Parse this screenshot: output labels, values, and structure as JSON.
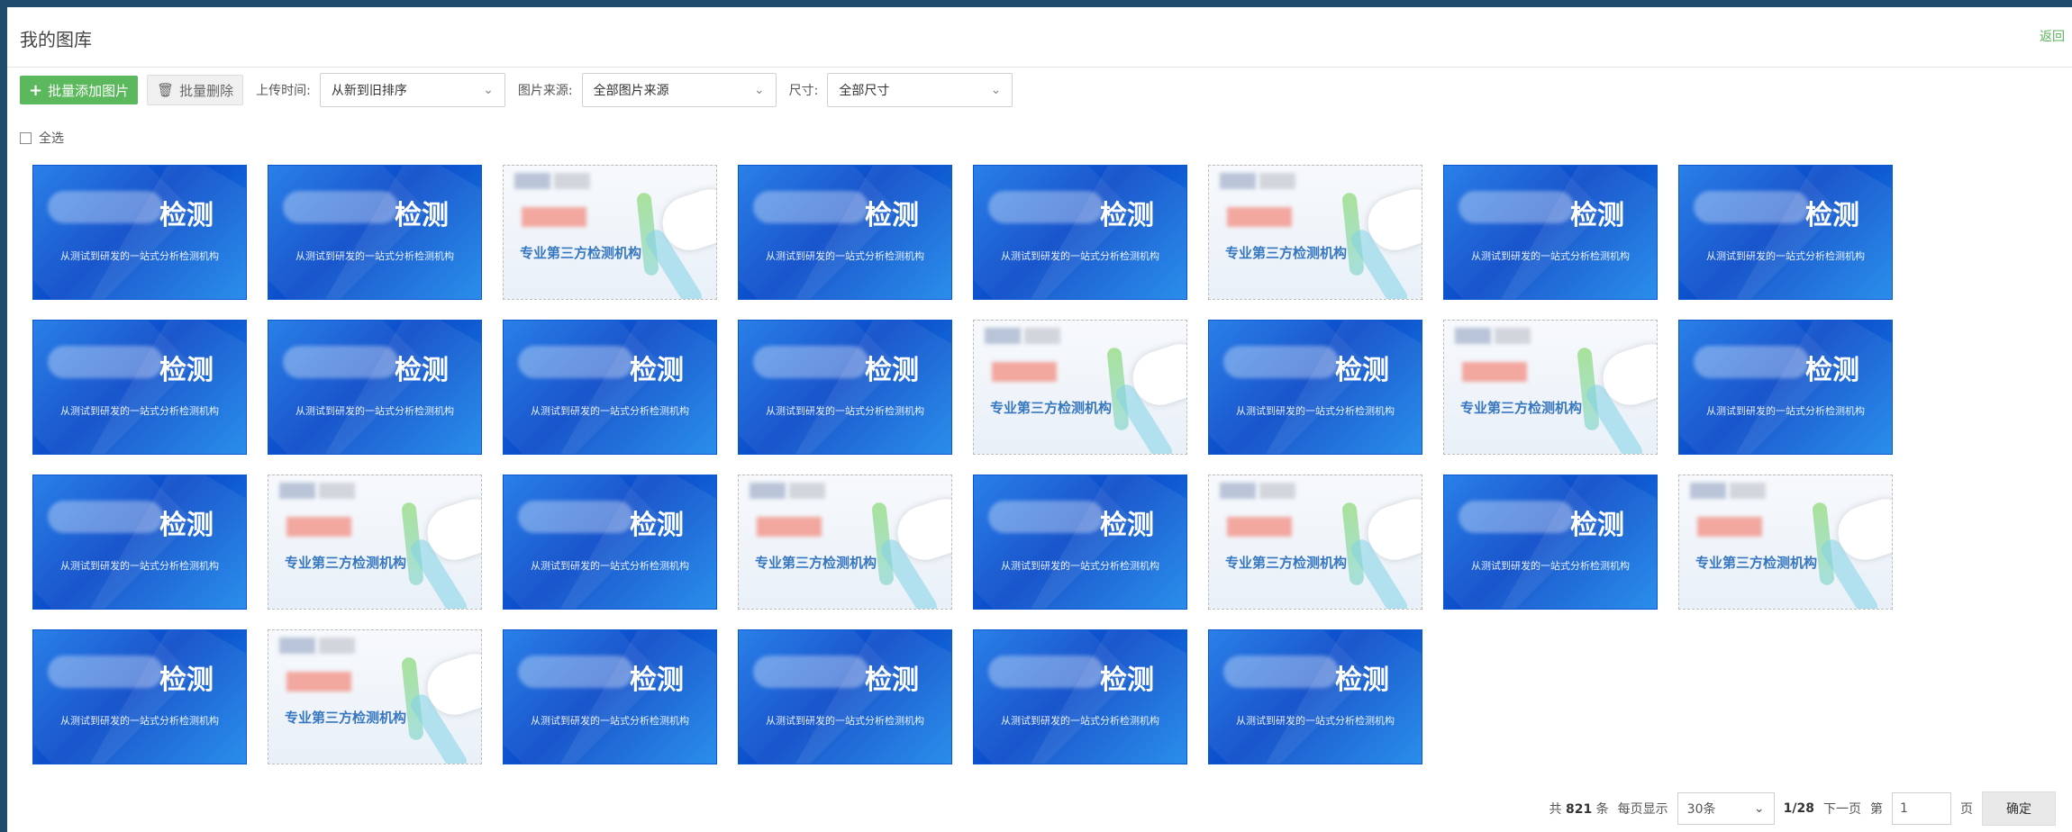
{
  "header": {
    "title": "我的图库",
    "back_label": "返回"
  },
  "toolbar": {
    "add_label": "批量添加图片",
    "delete_label": "批量删除",
    "upload_time_label": "上传时间:",
    "upload_time_value": "从新到旧排序",
    "source_label": "图片来源:",
    "source_value": "全部图片来源",
    "size_label": "尺寸:",
    "size_value": "全部尺寸",
    "select_all_label": "全选"
  },
  "images": [
    {
      "variant": "blue",
      "big": "检测",
      "sub": "从测试到研发的一站式分析检测机构"
    },
    {
      "variant": "blue",
      "big": "检测",
      "sub": "从测试到研发的一站式分析检测机构"
    },
    {
      "variant": "lab",
      "text": "专业第三方检测机构"
    },
    {
      "variant": "blue",
      "big": "检测",
      "sub": "从测试到研发的一站式分析检测机构"
    },
    {
      "variant": "blue",
      "big": "检测",
      "sub": "从测试到研发的一站式分析检测机构"
    },
    {
      "variant": "lab",
      "text": "专业第三方检测机构"
    },
    {
      "variant": "blue",
      "big": "检测",
      "sub": "从测试到研发的一站式分析检测机构"
    },
    {
      "variant": "blue",
      "big": "检测",
      "sub": "从测试到研发的一站式分析检测机构"
    },
    {
      "variant": "blue",
      "big": "检测",
      "sub": "从测试到研发的一站式分析检测机构"
    },
    {
      "variant": "blue",
      "big": "检测",
      "sub": "从测试到研发的一站式分析检测机构"
    },
    {
      "variant": "blue",
      "big": "检测",
      "sub": "从测试到研发的一站式分析检测机构"
    },
    {
      "variant": "blue",
      "big": "检测",
      "sub": "从测试到研发的一站式分析检测机构"
    },
    {
      "variant": "lab",
      "text": "专业第三方检测机构"
    },
    {
      "variant": "blue",
      "big": "检测",
      "sub": "从测试到研发的一站式分析检测机构"
    },
    {
      "variant": "lab",
      "text": "专业第三方检测机构"
    },
    {
      "variant": "blue",
      "big": "检测",
      "sub": "从测试到研发的一站式分析检测机构"
    },
    {
      "variant": "blue",
      "big": "检测",
      "sub": "从测试到研发的一站式分析检测机构"
    },
    {
      "variant": "lab",
      "text": "专业第三方检测机构"
    },
    {
      "variant": "blue",
      "big": "检测",
      "sub": "从测试到研发的一站式分析检测机构"
    },
    {
      "variant": "lab",
      "text": "专业第三方检测机构"
    },
    {
      "variant": "blue",
      "big": "检测",
      "sub": "从测试到研发的一站式分析检测机构"
    },
    {
      "variant": "lab",
      "text": "专业第三方检测机构"
    },
    {
      "variant": "blue",
      "big": "检测",
      "sub": "从测试到研发的一站式分析检测机构"
    },
    {
      "variant": "lab",
      "text": "专业第三方检测机构"
    },
    {
      "variant": "blue",
      "big": "检测",
      "sub": "从测试到研发的一站式分析检测机构"
    },
    {
      "variant": "lab",
      "text": "专业第三方检测机构"
    },
    {
      "variant": "blue",
      "big": "检测",
      "sub": "从测试到研发的一站式分析检测机构"
    },
    {
      "variant": "blue",
      "big": "检测",
      "sub": "从测试到研发的一站式分析检测机构"
    },
    {
      "variant": "blue",
      "big": "检测",
      "sub": "从测试到研发的一站式分析检测机构"
    },
    {
      "variant": "blue",
      "big": "检测",
      "sub": "从测试到研发的一站式分析检测机构"
    }
  ],
  "pagination": {
    "total_text": "共",
    "total_count": "821",
    "total_unit": "条",
    "per_page_label": "每页显示",
    "per_page_value": "30条",
    "page_status": "1/28",
    "next_label": "下一页",
    "goto_prefix": "第",
    "goto_value": "1",
    "goto_suffix": "页",
    "confirm_label": "确定"
  }
}
